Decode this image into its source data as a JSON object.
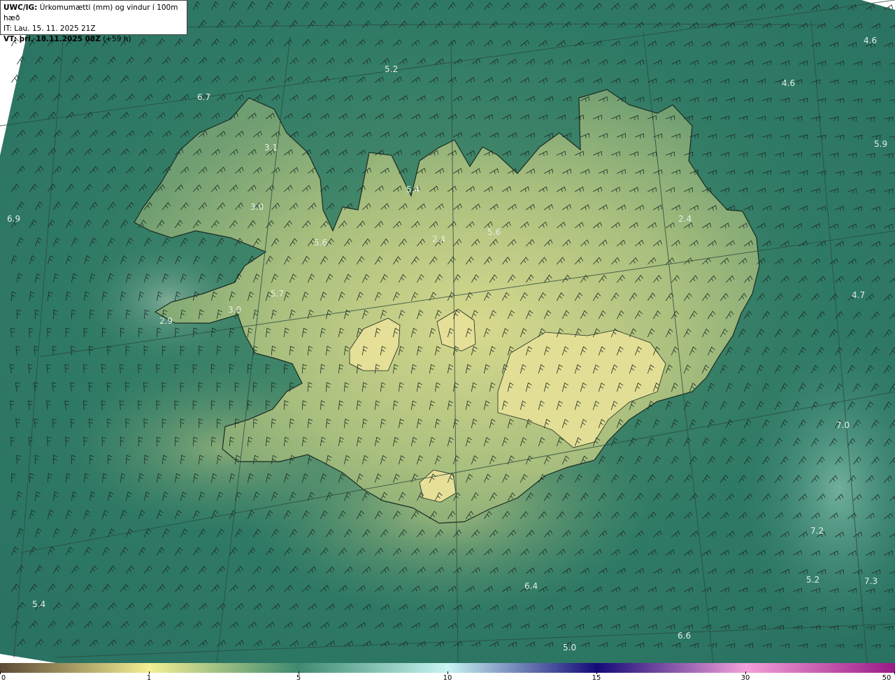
{
  "header": {
    "line1_bold": "UWC/IG:",
    "line1_rest": " Úrkomumætti (mm) og vindur í 100m hæð",
    "line2": "IT: Lau. 15. 11. 2025 21Z",
    "line3_bold": "VT: þri. 18.11.2025 08Z",
    "line3_rest": " (+59 h)"
  },
  "colorbar": {
    "ticks": [
      "0",
      "1",
      "5",
      "10",
      "15",
      "30",
      "50"
    ],
    "colors": [
      "#5c4a36",
      "#f4ef94",
      "#3e8a70",
      "#c8f4f2",
      "#140a78",
      "#f4a0d8",
      "#9a1a86"
    ]
  },
  "map": {
    "ocean_color": "#2f7a66",
    "land_color": "#c9d289",
    "value_labels": [
      "5.2",
      "4.6",
      "4.6",
      "6.7",
      "3.1",
      "5.9",
      "5.4",
      "3.0",
      "6.9",
      "5.6",
      "2.4",
      "5.6",
      "2.4",
      "5.7",
      "3.0",
      "2.9",
      "4.7",
      "7.0",
      "7.2",
      "5.2",
      "7.3",
      "6.4",
      "5.4",
      "6.6",
      "5.0"
    ]
  }
}
